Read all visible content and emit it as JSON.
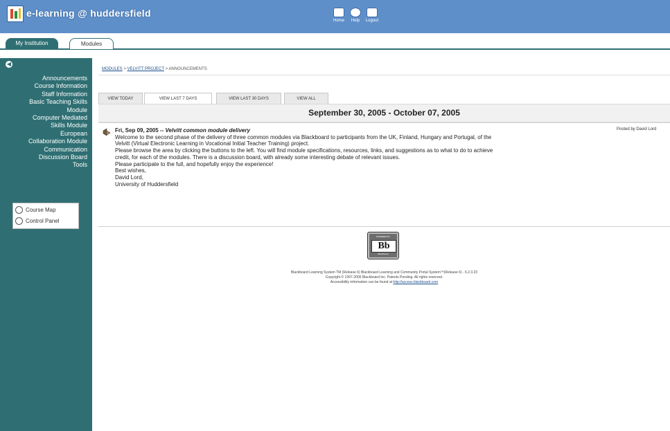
{
  "header": {
    "site_title": "e-learning @ huddersfield",
    "nav": [
      {
        "label": "Home",
        "icon": "home-icon"
      },
      {
        "label": "Help",
        "icon": "help-icon"
      },
      {
        "label": "Logout",
        "icon": "logout-icon"
      }
    ]
  },
  "tabs": [
    {
      "label": "My Institution",
      "active": false
    },
    {
      "label": "Modules",
      "active": true
    }
  ],
  "sidebar": {
    "collapse_icon": "arrow-left-icon",
    "items": [
      "Announcements",
      "Course Information",
      "Staff Information",
      "Basic Teaching Skills",
      "Module",
      "Computer Mediated",
      "Skills Module",
      "European",
      "Collaboration Module",
      "Communication",
      "Discussion Board",
      "Tools"
    ],
    "tools": [
      {
        "label": "Course Map",
        "icon": "course-map-icon"
      },
      {
        "label": "Control Panel",
        "icon": "control-panel-icon"
      }
    ]
  },
  "breadcrumb": {
    "part1": "MODULES",
    "sep": ">",
    "part2": "VELVITT PROJECT",
    "part3": "ANNOUNCEMENTS"
  },
  "view_tabs": [
    {
      "label": "VIEW TODAY",
      "selected": false
    },
    {
      "label": "VIEW LAST 7 DAYS",
      "selected": true
    },
    {
      "label": "VIEW LAST 30 DAYS",
      "selected": false
    },
    {
      "label": "VIEW ALL",
      "selected": false
    }
  ],
  "date_range": "September 30, 2005 - October 07, 2005",
  "announcement": {
    "date": "Fri, Sep 09, 2005 --",
    "subject": "Velvitt common module delivery",
    "posted_by": "Posted by David Lord",
    "lines": [
      "Welcome to the second phase of the delivery of three common modules via Blackboard to participants from the UK, Finland, Hungary and Portugal, of the",
      "Velvitt (Virtual Electronic Learning in Vocational Initial Teacher Training) project.",
      "Please browse the area by clicking the buttons to the left. You will find module specifications, resources, links, and suggestions as to what to do to achieve",
      "credit, for each of the modules. There is a discussion board, with already some interesting debate of relevant issues.",
      "Please participate to the full, and hopefully enjoy the experience!",
      "Best wishes,",
      "David Lord,",
      "University of Huddersfield"
    ]
  },
  "bb_logo": {
    "top": "POWERED BY",
    "mark": "Bb",
    "bottom": "Blackboard"
  },
  "footer": {
    "line1": "Blackboard Learning System TM (Release 6) Blackboard Learning and Community Portal System™(Release 6) - 6.2.3.23",
    "line2": "Copyright © 1997-2005 Blackboard Inc. Patents Pending. All rights reserved.",
    "line3_prefix": "Accessibility information can be found at",
    "line3_link": "http://access.blackboard.com"
  },
  "colors": {
    "header": "#5f8fc9",
    "sidebar": "#2f6f73"
  }
}
